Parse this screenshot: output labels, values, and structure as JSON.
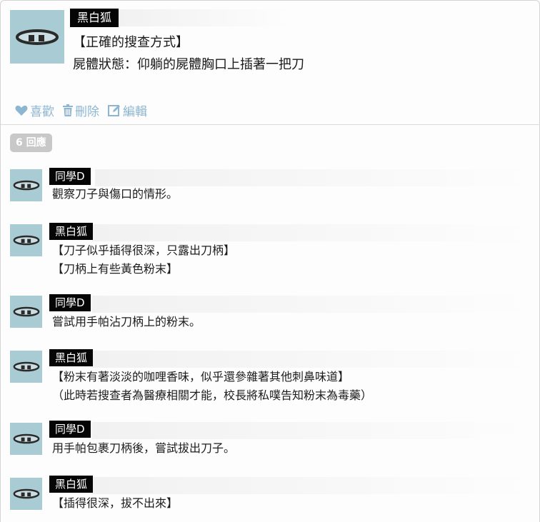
{
  "post": {
    "author": "黑白狐",
    "lines": [
      "【正確的搜查方式】",
      "屍體狀態：仰躺的屍體胸口上插著一把刀"
    ],
    "actions": {
      "like": "喜歡",
      "delete": "刪除",
      "edit": "編輯"
    }
  },
  "replies_badge": "6 回應",
  "replies": [
    {
      "author": "同學D",
      "lines": [
        "觀察刀子與傷口的情形。"
      ]
    },
    {
      "author": "黑白狐",
      "lines": [
        "【刀子似乎插得很深，只露出刀柄】",
        "【刀柄上有些黃色粉末】"
      ]
    },
    {
      "author": "同學D",
      "lines": [
        "嘗試用手帕沾刀柄上的粉末。"
      ]
    },
    {
      "author": "黑白狐",
      "lines": [
        "【粉末有著淡淡的咖哩香味，似乎還參雜著其他刺鼻味道】",
        "（此時若搜查者為醫療相關才能，校長將私噗告知粉末為毒藥）"
      ]
    },
    {
      "author": "同學D",
      "lines": [
        "用手帕包裹刀柄後，嘗試拔出刀子。"
      ]
    },
    {
      "author": "黑白狐",
      "lines": [
        "【插得很深，拔不出來】"
      ]
    }
  ],
  "colors": {
    "avatar_bg": "#a9cbd4",
    "action_blue": "#8db6d2",
    "badge_gray": "#c8c8c8"
  },
  "icons": {
    "avatar": "eye-face-icon",
    "like": "heart-icon",
    "delete": "trash-icon",
    "edit": "edit-icon"
  }
}
